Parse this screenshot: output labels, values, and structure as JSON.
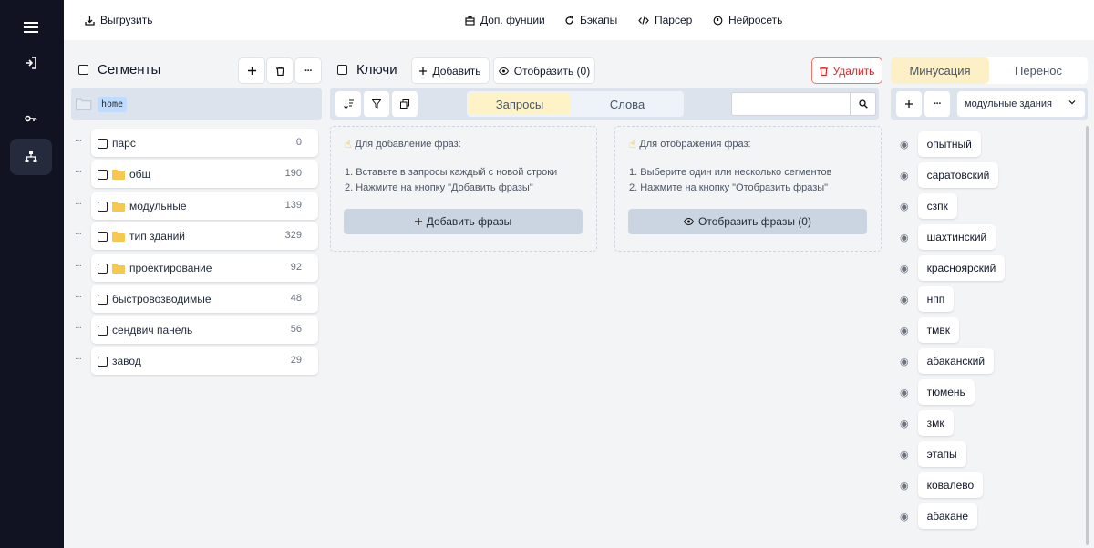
{
  "topbar": {
    "export_label": "Выгрузить",
    "extra_label": "Доп. фунции",
    "backups_label": "Бэкапы",
    "parser_label": "Парсер",
    "neuro_label": "Нейросеть"
  },
  "segments": {
    "title": "Сегменты",
    "root_label": "home",
    "items": [
      {
        "label": "парс",
        "count": "0",
        "folder": false
      },
      {
        "label": "общ",
        "count": "190",
        "folder": true
      },
      {
        "label": "модульные",
        "count": "139",
        "folder": true
      },
      {
        "label": "тип зданий",
        "count": "329",
        "folder": true
      },
      {
        "label": "проектирование",
        "count": "92",
        "folder": true
      },
      {
        "label": "быстровозводимые",
        "count": "48",
        "folder": false
      },
      {
        "label": "сендвич панель",
        "count": "56",
        "folder": false
      },
      {
        "label": "завод",
        "count": "29",
        "folder": false
      }
    ]
  },
  "keys": {
    "title": "Ключи",
    "add_label": "Добавить",
    "show_label": "Отобразить (0)",
    "delete_label": "Удалить",
    "toggle": {
      "requests": "Запросы",
      "words": "Слова"
    },
    "search_placeholder": "",
    "add_info": {
      "title": "Для добавление фраз:",
      "line1": "1. Вставьте в запросы каждый с новой строки",
      "line2": "2. Нажмите на кнопку \"Добавить фразы\"",
      "button": "Добавить фразы"
    },
    "show_info": {
      "title": "Для отображения фраз:",
      "line1": "1. Выберите один или несколько сегментов",
      "line2": "2. Нажмите на кнопку \"Отобразить фразы\"",
      "button": "Отобразить фразы (0)"
    }
  },
  "right": {
    "tab_minus": "Минусация",
    "tab_transfer": "Перенос",
    "select_value": "модульные здания",
    "words": [
      "опытный",
      "саратовский",
      "сзпк",
      "шахтинский",
      "красноярский",
      "нпп",
      "тмвк",
      "абаканский",
      "тюмень",
      "змк",
      "этапы",
      "ковалево",
      "абакане"
    ]
  },
  "icons": {
    "rail": [
      "menu-icon",
      "login-icon",
      "key-icon",
      "sitemap-icon"
    ]
  }
}
